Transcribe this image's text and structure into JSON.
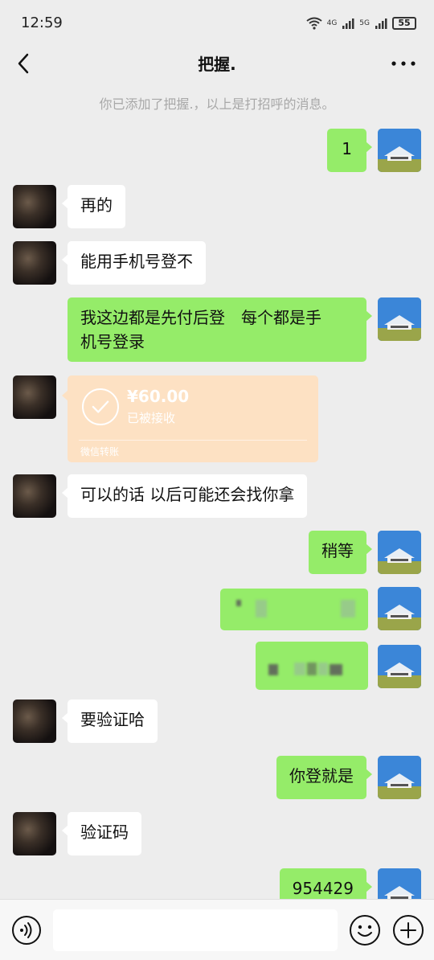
{
  "status_bar": {
    "time": "12:59",
    "network_1": "4G",
    "network_2": "5G",
    "battery": "55"
  },
  "header": {
    "title": "把握."
  },
  "system_message": "你已添加了把握.，以上是打招呼的消息。",
  "messages": [
    {
      "side": "out",
      "text": "1"
    },
    {
      "side": "in",
      "text": "再的"
    },
    {
      "side": "in",
      "text": "能用手机号登不"
    },
    {
      "side": "out",
      "line1": "我这边都是先付后登　每个都是手",
      "line2": "机号登录"
    },
    {
      "side": "in",
      "type": "transfer",
      "amount": "¥60.00",
      "status": "已被接收",
      "footer": "微信转账"
    },
    {
      "side": "in",
      "text": "可以的话 以后可能还会找你拿"
    },
    {
      "side": "out",
      "text": "稍等"
    },
    {
      "side": "out",
      "type": "redacted"
    },
    {
      "side": "out",
      "type": "redacted"
    },
    {
      "side": "in",
      "text": "要验证哈"
    },
    {
      "side": "out",
      "text": "你登就是"
    },
    {
      "side": "in",
      "text": "验证码"
    },
    {
      "side": "out",
      "text": "954429"
    }
  ],
  "input_bar": {
    "placeholder": "",
    "icons": [
      "voice-icon",
      "emoji-icon",
      "plus-icon"
    ]
  },
  "colors": {
    "background": "#ededed",
    "outgoing_bubble": "#95ec69",
    "incoming_bubble": "#ffffff",
    "transfer_card": "#fde1c3"
  }
}
